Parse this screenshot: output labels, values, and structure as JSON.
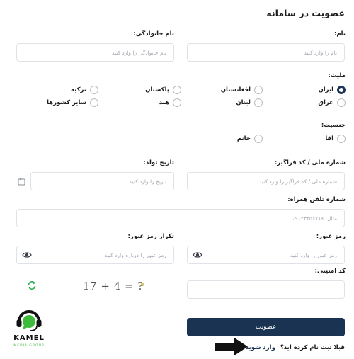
{
  "page": {
    "title": "عضویت در سامانه"
  },
  "fields": {
    "first_name": {
      "label": "نام:",
      "placeholder": "نام را وارد کنید"
    },
    "last_name": {
      "label": "نام خانوادگی:",
      "placeholder": "نام خانوادگی را وارد کنید"
    },
    "nationality": {
      "label": "ملیت:",
      "options": [
        "ایران",
        "افغانستان",
        "پاکستان",
        "ترکیه",
        "عراق",
        "لبنان",
        "هند",
        "سایر کشورها"
      ],
      "selected": "ایران"
    },
    "gender": {
      "label": "جنسیت:",
      "options": [
        "آقا",
        "خانم"
      ]
    },
    "national_id": {
      "label": "شماره ملی / کد فراگیر:",
      "placeholder": "شماره ملی / کد فراگیر را وارد کنید"
    },
    "birth_date": {
      "label": "تاریخ تولد:",
      "placeholder": "تاریخ را وارد کنید"
    },
    "mobile": {
      "label": "شماره تلفن همراه:",
      "placeholder": "مثال: ۰۹۱۲۳۴۵۶۷۸۹"
    },
    "password": {
      "label": "رمز عبور:",
      "placeholder": "رمز عبور را وارد کنید"
    },
    "password_repeat": {
      "label": "تکرار رمز عبور:",
      "placeholder": "رمز عبور را دوباره وارد کنید"
    },
    "captcha": {
      "label": "کد امنیتی:",
      "image_text": "17 + 4 = ?"
    }
  },
  "actions": {
    "submit_label": "عضویت",
    "login_prompt": "قبلا ثبت نام کرده اید؟",
    "login_link": "وارد شوید"
  },
  "watermark": {
    "brand": "KAMEL",
    "sub": "MEDIA GROUP"
  },
  "icons": {
    "calendar": "calendar-icon",
    "eye": "eye-icon",
    "refresh": "refresh-icon",
    "arrow": "arrow-right-icon"
  },
  "colors": {
    "primary": "#1a3352",
    "refresh": "#2eaa4f",
    "brand_green": "#3dbb3d"
  }
}
